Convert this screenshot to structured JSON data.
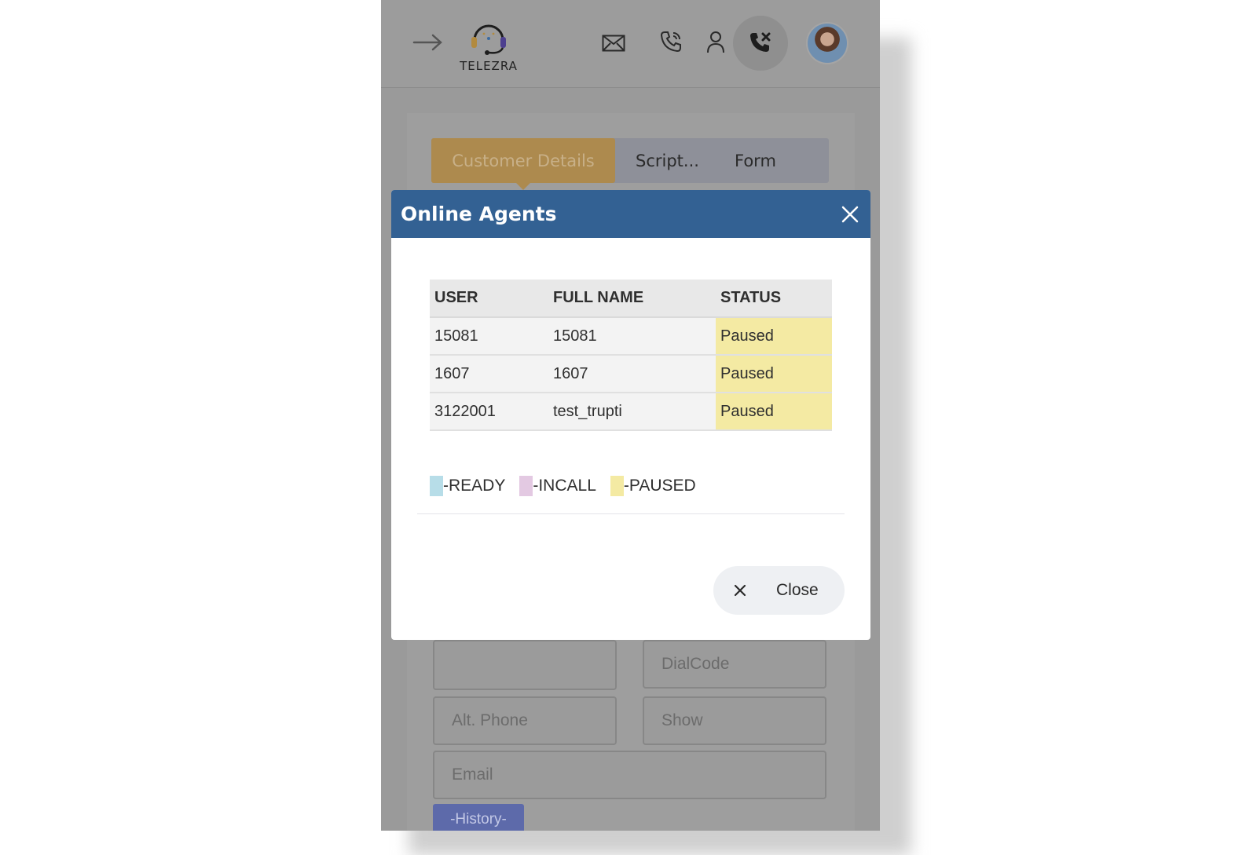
{
  "app": {
    "logo_text": "TELEZRA"
  },
  "tabs": [
    {
      "label": "Customer Details"
    },
    {
      "label": "Script..."
    },
    {
      "label": "Form"
    }
  ],
  "form": {
    "dialcode_placeholder": "DialCode",
    "altphone_placeholder": "Alt. Phone",
    "show_placeholder": "Show",
    "email_placeholder": "Email",
    "history_label": "-History-"
  },
  "modal": {
    "title": "Online Agents",
    "table": {
      "headers": [
        "USER",
        "FULL NAME",
        "STATUS"
      ],
      "rows": [
        {
          "user": "15081",
          "full_name": "15081",
          "status": "Paused"
        },
        {
          "user": "1607",
          "full_name": "1607",
          "status": "Paused"
        },
        {
          "user": "3122001",
          "full_name": "test_trupti",
          "status": "Paused"
        }
      ]
    },
    "legend": [
      {
        "label": "-READY",
        "color": "#b7dde8"
      },
      {
        "label": "-INCALL",
        "color": "#e3c9e2"
      },
      {
        "label": "-PAUSED",
        "color": "#f4eaa3"
      }
    ],
    "close_label": "Close"
  },
  "colors": {
    "modal_header": "#336193",
    "tab_active": "#ad8a4e",
    "paused": "#f4eaa3",
    "history_button": "#5d6aaa"
  }
}
